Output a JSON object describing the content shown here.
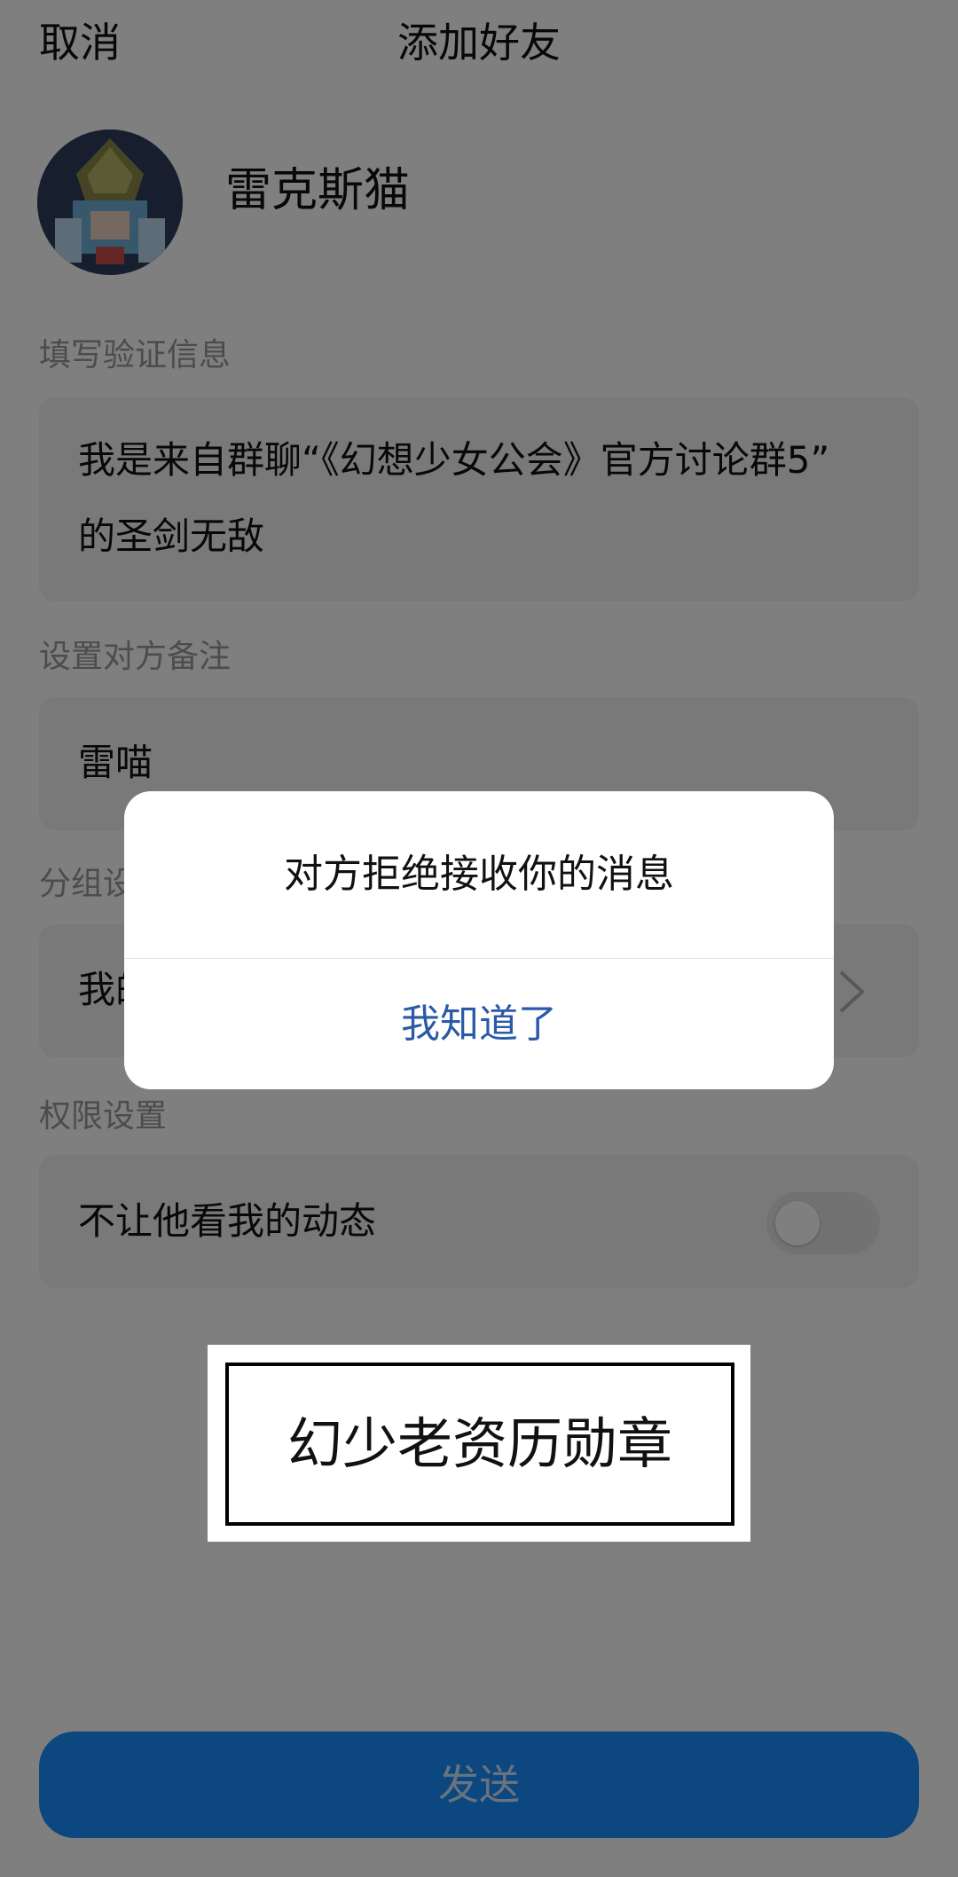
{
  "nav": {
    "cancel_label": "取消",
    "title": "添加好友"
  },
  "profile": {
    "nickname": "雷克斯猫",
    "avatar_icon": "avatar-image"
  },
  "verify": {
    "label": "填写验证信息",
    "line1": "我是来自群聊“《幻想少女公会》官方讨论群5”",
    "line2": "的圣剑无敌"
  },
  "remark": {
    "label": "设置对方备注",
    "value": "雷喵"
  },
  "group": {
    "label": "分组设",
    "value": "我的",
    "chevron_icon": "chevron-right-icon"
  },
  "permission": {
    "label": "权限设置",
    "toggle_label": "不让他看我的动态",
    "toggle_on": false
  },
  "send": {
    "label": "发送"
  },
  "dialog": {
    "message": "对方拒绝接收你的消息",
    "button_label": "我知道了"
  },
  "badge": {
    "text": "幻少老资历勋章"
  },
  "colors": {
    "accent": "#1a8fff",
    "dialog_button": "#2a5aa8",
    "overlay": "rgba(0,0,0,0.5)"
  }
}
